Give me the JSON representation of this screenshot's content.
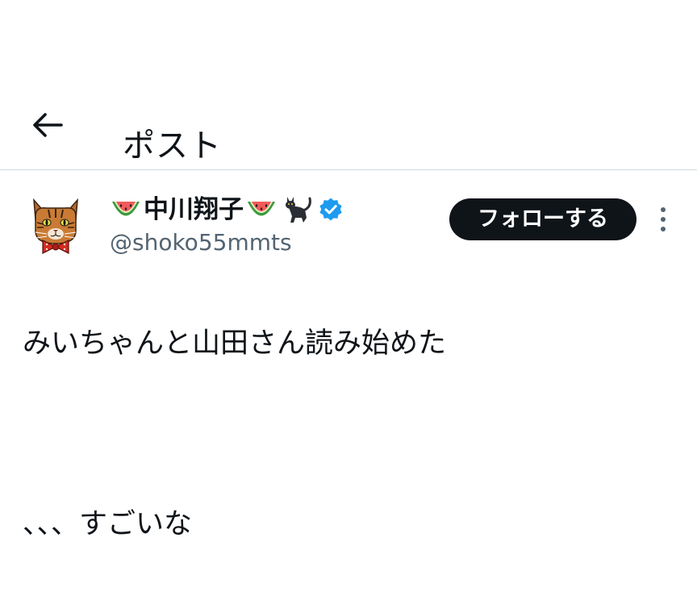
{
  "header": {
    "title": "ポスト",
    "back_icon": "arrow-left-icon"
  },
  "author": {
    "display_name": "中川翔子",
    "handle": "@shoko55mmts",
    "name_emoji_left": "watermelon-icon",
    "name_emoji_right": "watermelon-icon",
    "name_emoji_extra": "black-cat-icon",
    "verified_icon": "verified-badge-icon",
    "avatar_icon": "cat-avatar-icon"
  },
  "actions": {
    "follow_label": "フォローする",
    "more_icon": "more-vertical-icon"
  },
  "post": {
    "line1": "みいちゃんと山田さん読み始めた",
    "line2": "、、、すごいな"
  },
  "colors": {
    "text": "#0f1419",
    "secondary_text": "#536471",
    "divider": "#cfd9de",
    "follow_bg": "#0f1419",
    "verified": "#1d9bf0"
  }
}
